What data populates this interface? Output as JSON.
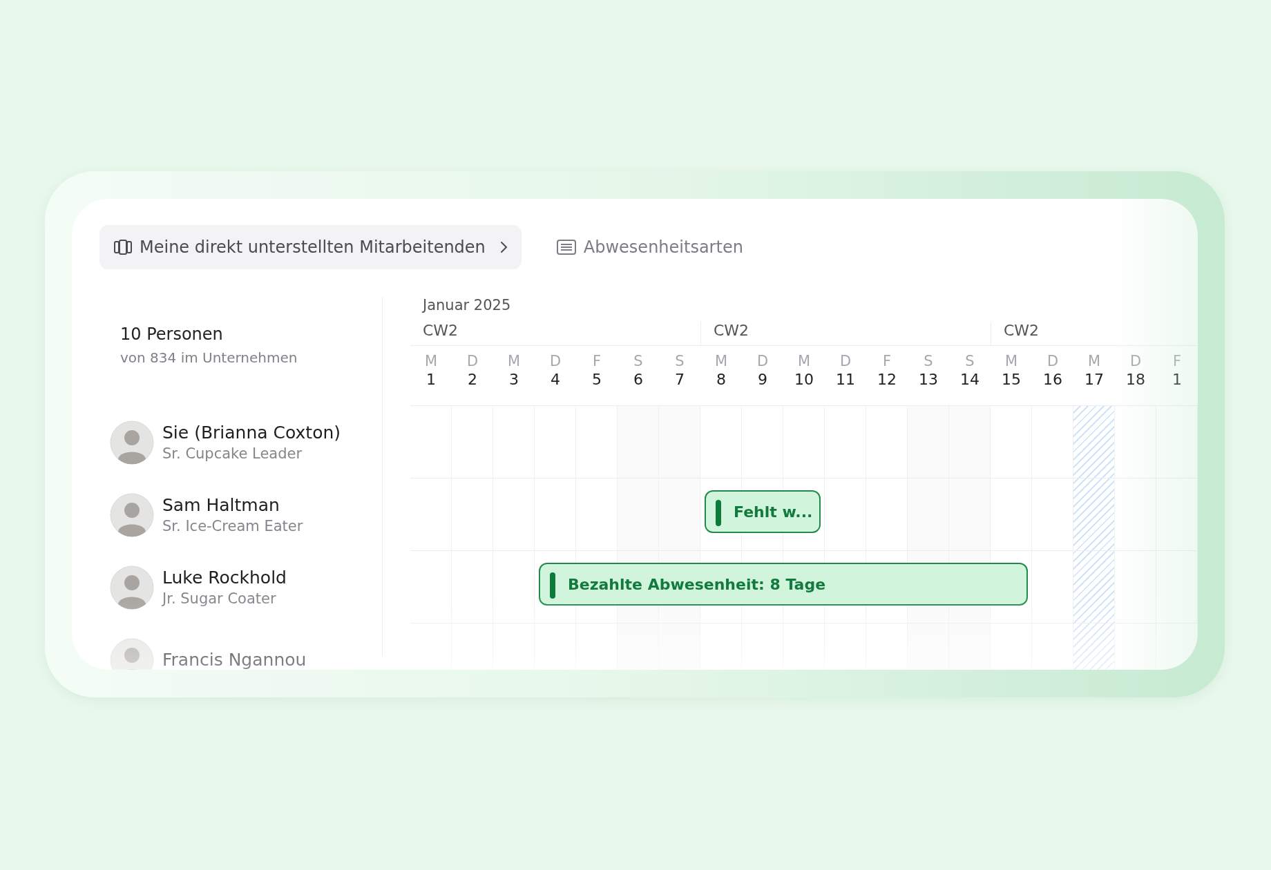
{
  "tabs": [
    {
      "label": "Meine direkt unterstellten Mitarbeitenden",
      "selected": true,
      "kind": "team"
    },
    {
      "label": "Abwesenheitsarten",
      "selected": false,
      "kind": "list"
    }
  ],
  "summary": {
    "count": "10 Personen",
    "subtitle": "von 834 im Unternehmen"
  },
  "calendar": {
    "month": "Januar 2025",
    "weeks": [
      {
        "label": "CW2"
      },
      {
        "label": "CW2"
      },
      {
        "label": "CW2"
      }
    ],
    "days": [
      {
        "weekday": "M",
        "day": "1",
        "kind": "workday"
      },
      {
        "weekday": "D",
        "day": "2",
        "kind": "workday"
      },
      {
        "weekday": "M",
        "day": "3",
        "kind": "workday"
      },
      {
        "weekday": "D",
        "day": "4",
        "kind": "workday"
      },
      {
        "weekday": "F",
        "day": "5",
        "kind": "workday"
      },
      {
        "weekday": "S",
        "day": "6",
        "kind": "weekend"
      },
      {
        "weekday": "S",
        "day": "7",
        "kind": "weekend"
      },
      {
        "weekday": "M",
        "day": "8",
        "kind": "workday"
      },
      {
        "weekday": "D",
        "day": "9",
        "kind": "workday"
      },
      {
        "weekday": "M",
        "day": "10",
        "kind": "workday"
      },
      {
        "weekday": "D",
        "day": "11",
        "kind": "workday"
      },
      {
        "weekday": "F",
        "day": "12",
        "kind": "workday"
      },
      {
        "weekday": "S",
        "day": "13",
        "kind": "weekend"
      },
      {
        "weekday": "S",
        "day": "14",
        "kind": "weekend"
      },
      {
        "weekday": "M",
        "day": "15",
        "kind": "workday"
      },
      {
        "weekday": "D",
        "day": "16",
        "kind": "workday"
      },
      {
        "weekday": "M",
        "day": "17",
        "kind": "hatched"
      },
      {
        "weekday": "D",
        "day": "18",
        "kind": "workday"
      },
      {
        "weekday": "F",
        "day": "1",
        "kind": "workday"
      }
    ],
    "rows": [
      {
        "name": "Sie (Brianna Coxton)",
        "role": "Sr. Cupcake Leader"
      },
      {
        "name": "Sam Haltman",
        "role": "Sr. Ice-Cream Eater",
        "cells": [
          {
            "kind": "empty"
          },
          {
            "kind": "empty"
          },
          {
            "kind": "empty"
          },
          {
            "kind": "empty"
          },
          {
            "kind": "empty"
          },
          {
            "kind": "empty"
          },
          {
            "kind": "empty"
          },
          {
            "kind": "bar",
            "label": "Fehlt w..."
          },
          {
            "kind": "continued"
          },
          {
            "kind": "continued"
          },
          {
            "kind": "empty"
          },
          {
            "kind": "empty"
          },
          {
            "kind": "empty"
          },
          {
            "kind": "empty"
          },
          {
            "kind": "empty"
          },
          {
            "kind": "empty"
          },
          {
            "kind": "empty"
          },
          {
            "kind": "empty"
          },
          {
            "kind": "empty"
          }
        ]
      },
      {
        "name": "Luke Rockhold",
        "role": "Jr. Sugar Coater",
        "cells": [
          {
            "kind": "empty"
          },
          {
            "kind": "empty"
          },
          {
            "kind": "empty"
          },
          {
            "kind": "bar",
            "label": "Bezahlte Abwesenheit: 8 Tage"
          },
          {
            "kind": "continued"
          },
          {
            "kind": "continued"
          },
          {
            "kind": "continued"
          },
          {
            "kind": "continued"
          },
          {
            "kind": "continued"
          },
          {
            "kind": "continued"
          },
          {
            "kind": "continued"
          },
          {
            "kind": "continued"
          },
          {
            "kind": "continued"
          },
          {
            "kind": "continued"
          },
          {
            "kind": "continued"
          },
          {
            "kind": "empty"
          },
          {
            "kind": "empty"
          },
          {
            "kind": "empty"
          },
          {
            "kind": "empty"
          }
        ]
      },
      {
        "name": "Francis Ngannou"
      }
    ]
  }
}
